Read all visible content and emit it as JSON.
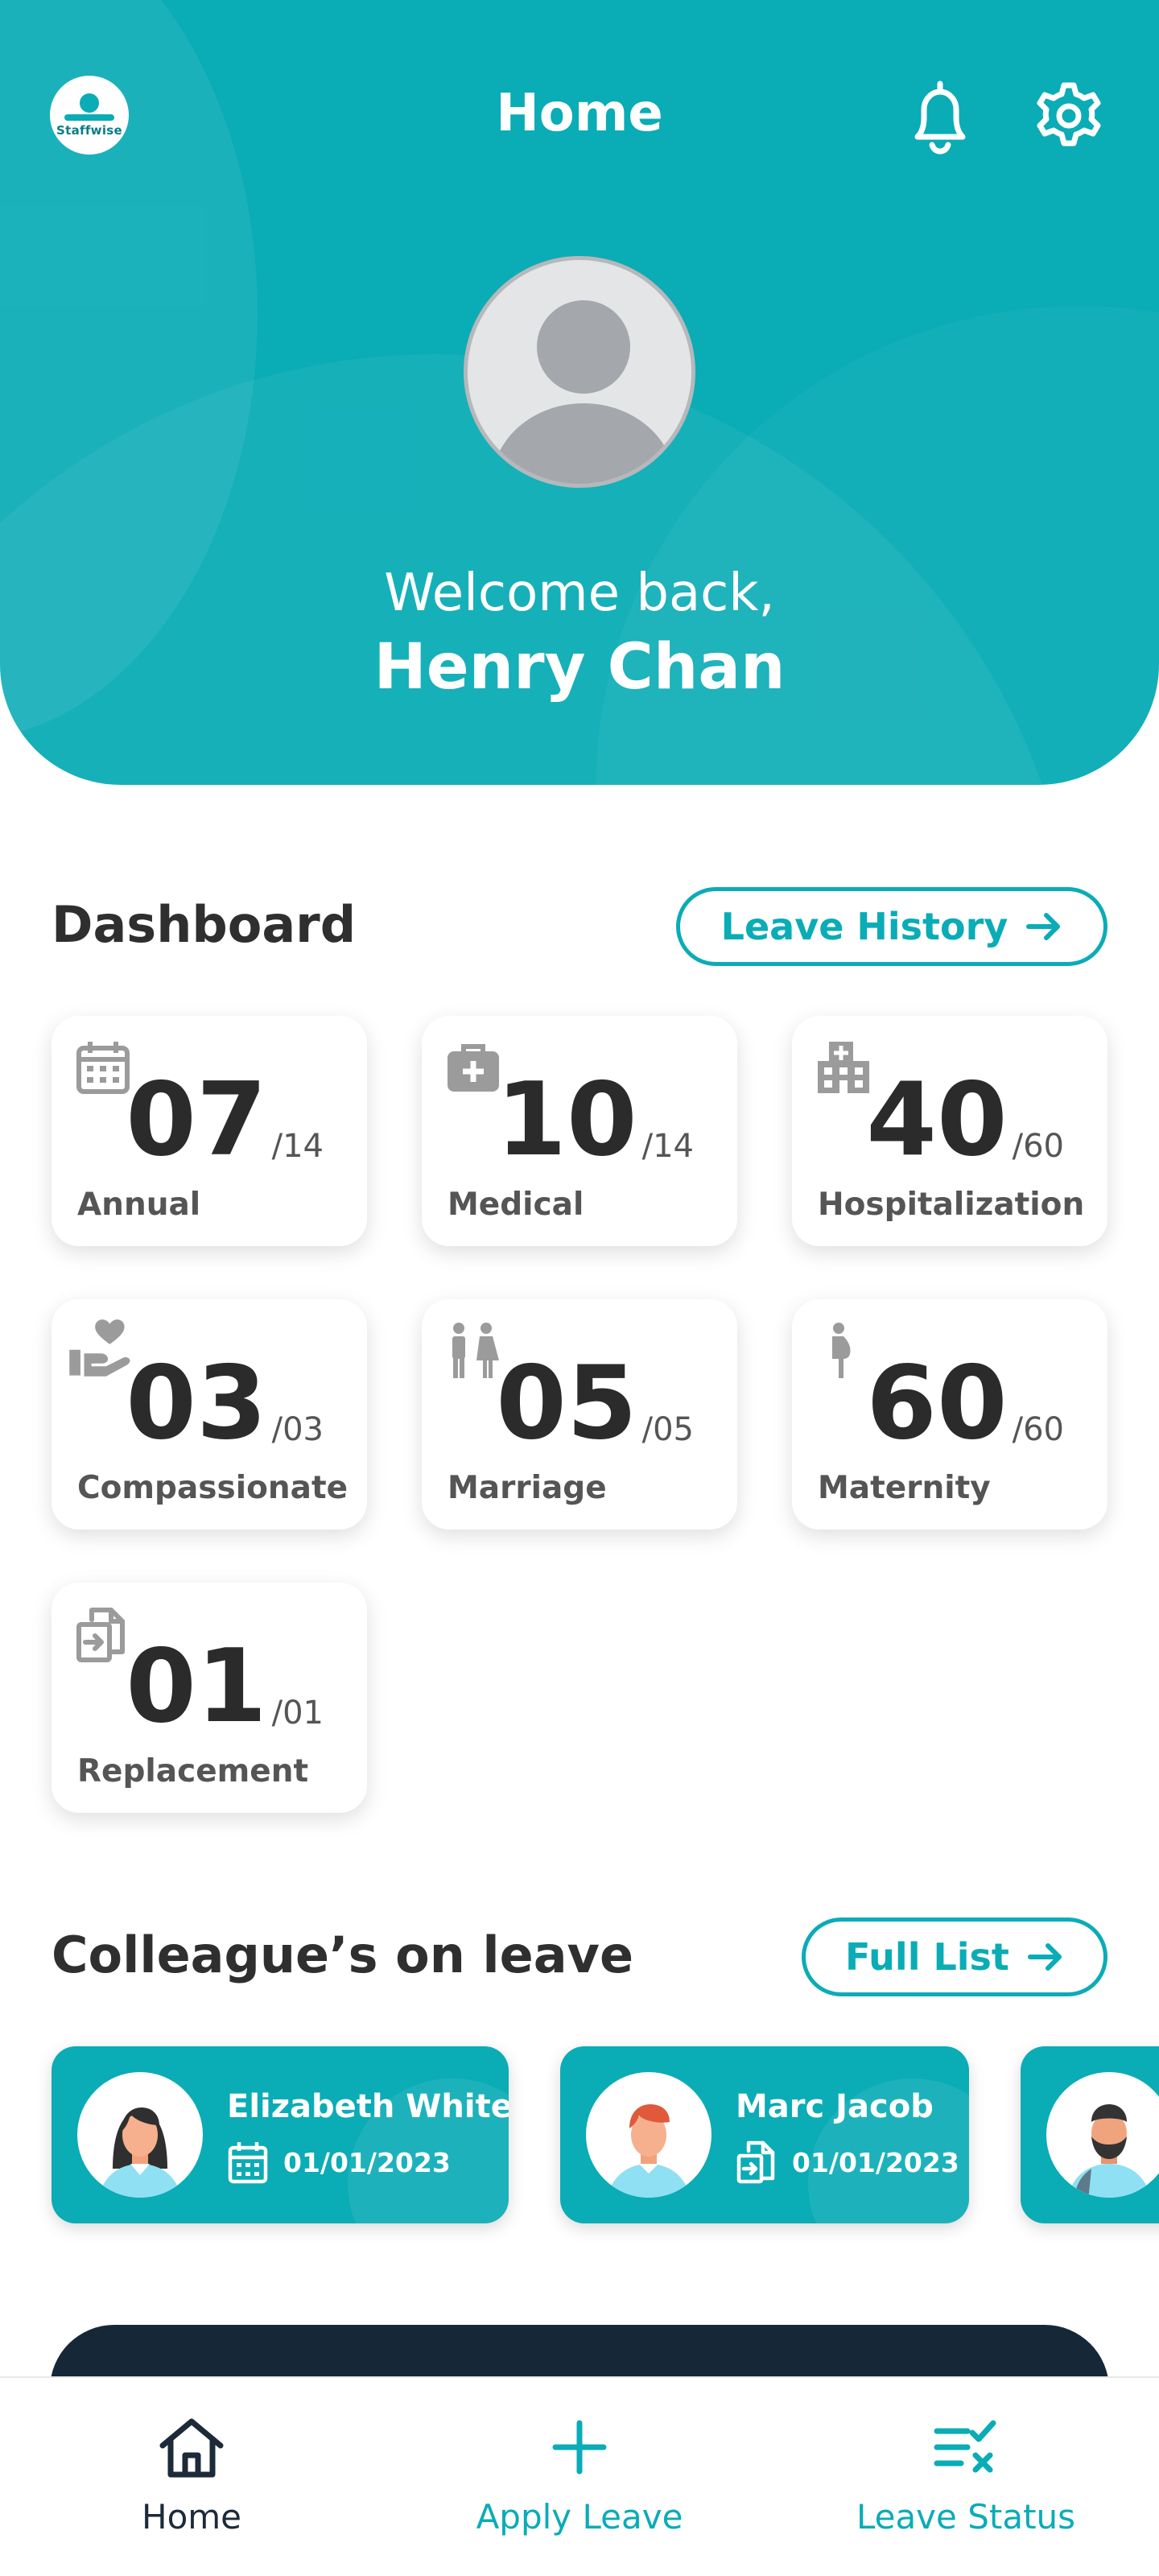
{
  "header": {
    "title": "Home",
    "logo_brand": "Staffwise",
    "welcome": "Welcome back,",
    "user_name": "Henry Chan"
  },
  "dashboard": {
    "title": "Dashboard",
    "history_button": "Leave History",
    "cards": [
      {
        "label": "Annual",
        "value": "07",
        "total": "/14",
        "icon": "calendar-icon"
      },
      {
        "label": "Medical",
        "value": "10",
        "total": "/14",
        "icon": "medical-bag-icon"
      },
      {
        "label": "Hospitalization",
        "value": "40",
        "total": "/60",
        "icon": "hospital-icon"
      },
      {
        "label": "Compassionate",
        "value": "03",
        "total": "/03",
        "icon": "heart-hand-icon"
      },
      {
        "label": "Marriage",
        "value": "05",
        "total": "/05",
        "icon": "couple-icon"
      },
      {
        "label": "Maternity",
        "value": "60",
        "total": "/60",
        "icon": "pregnant-icon"
      },
      {
        "label": "Replacement",
        "value": "01",
        "total": "/01",
        "icon": "replace-icon"
      }
    ]
  },
  "colleagues": {
    "title": "Colleague’s on leave",
    "full_list_button": "Full List",
    "items": [
      {
        "name": "Elizabeth White",
        "date": "01/01/2023",
        "icon": "calendar-icon"
      },
      {
        "name": "Marc Jacob",
        "date": "01/01/2023",
        "icon": "replace-icon"
      }
    ]
  },
  "nav": {
    "home": "Home",
    "apply": "Apply Leave",
    "status": "Leave Status"
  },
  "colors": {
    "primary": "#0aacb6",
    "dark": "#162838",
    "nav_active": "#1c2a3a"
  }
}
